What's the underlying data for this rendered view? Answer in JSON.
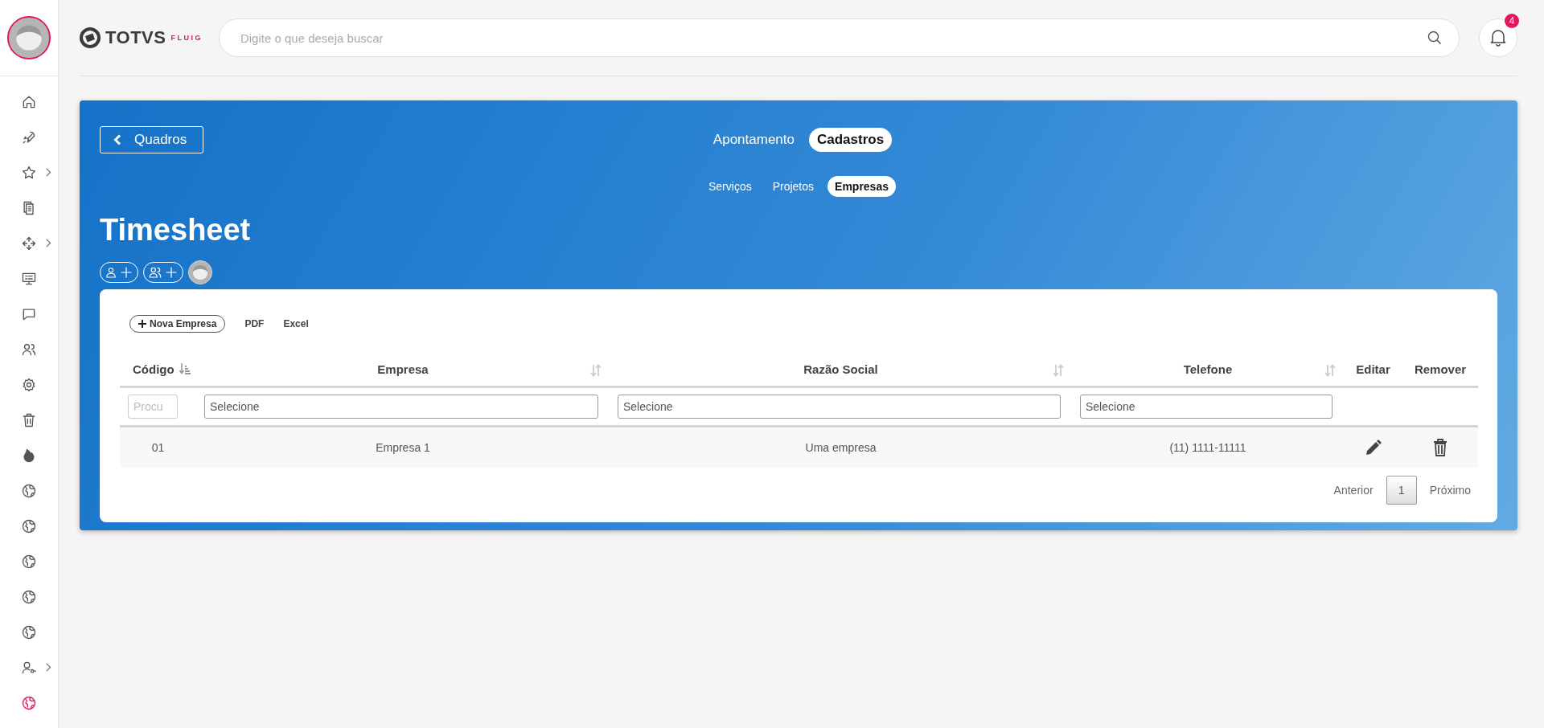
{
  "sidebar": {
    "items": [
      {
        "has_submenu": false,
        "selected": false
      },
      {
        "has_submenu": false,
        "selected": false
      },
      {
        "has_submenu": true,
        "selected": false
      },
      {
        "has_submenu": false,
        "selected": false
      },
      {
        "has_submenu": true,
        "selected": false
      },
      {
        "has_submenu": false,
        "selected": false
      },
      {
        "has_submenu": false,
        "selected": false
      },
      {
        "has_submenu": false,
        "selected": false
      },
      {
        "has_submenu": false,
        "selected": false
      },
      {
        "has_submenu": false,
        "selected": false
      },
      {
        "has_submenu": false,
        "selected": false
      },
      {
        "has_submenu": false,
        "selected": false
      },
      {
        "has_submenu": false,
        "selected": false
      },
      {
        "has_submenu": false,
        "selected": false
      },
      {
        "has_submenu": false,
        "selected": false
      },
      {
        "has_submenu": false,
        "selected": false
      },
      {
        "has_submenu": true,
        "selected": false
      },
      {
        "has_submenu": false,
        "selected": true
      }
    ]
  },
  "header": {
    "logo": {
      "brand": "TOTVS",
      "product": "FLUIG"
    },
    "search": {
      "placeholder": "Digite o que deseja buscar"
    },
    "notifications": {
      "count": "4"
    }
  },
  "page": {
    "back_button": "Quadros",
    "top_tabs": [
      {
        "label": "Apontamento",
        "selected": false
      },
      {
        "label": "Cadastros",
        "selected": true
      }
    ],
    "sub_tabs": [
      {
        "label": "Serviços",
        "selected": false
      },
      {
        "label": "Projetos",
        "selected": false
      },
      {
        "label": "Empresas",
        "selected": true
      }
    ],
    "title": "Timesheet"
  },
  "toolbar": {
    "new_button": "Nova Empresa",
    "links": [
      "PDF",
      "Excel"
    ]
  },
  "table": {
    "columns": [
      {
        "label": "Código",
        "sortable": true,
        "sorted": true,
        "filter": {
          "kind": "text",
          "placeholder": "Procu"
        }
      },
      {
        "label": "Empresa",
        "sortable": true,
        "sorted": false,
        "filter": {
          "kind": "select",
          "value": "Selecione"
        }
      },
      {
        "label": "Razão Social",
        "sortable": true,
        "sorted": false,
        "filter": {
          "kind": "select",
          "value": "Selecione"
        }
      },
      {
        "label": "Telefone",
        "sortable": true,
        "sorted": false,
        "filter": {
          "kind": "select",
          "value": "Selecione"
        }
      },
      {
        "label": "Editar",
        "sortable": false,
        "sorted": false,
        "filter": {
          "kind": "none"
        }
      },
      {
        "label": "Remover",
        "sortable": false,
        "sorted": false,
        "filter": {
          "kind": "none"
        }
      }
    ],
    "rows": [
      {
        "cells": [
          "01",
          "Empresa 1",
          "Uma empresa",
          "(11) 1111-11111"
        ]
      }
    ]
  },
  "pagination": {
    "previous": "Anterior",
    "pages": [
      {
        "label": "1",
        "selected": true
      }
    ],
    "next": "Próximo"
  }
}
